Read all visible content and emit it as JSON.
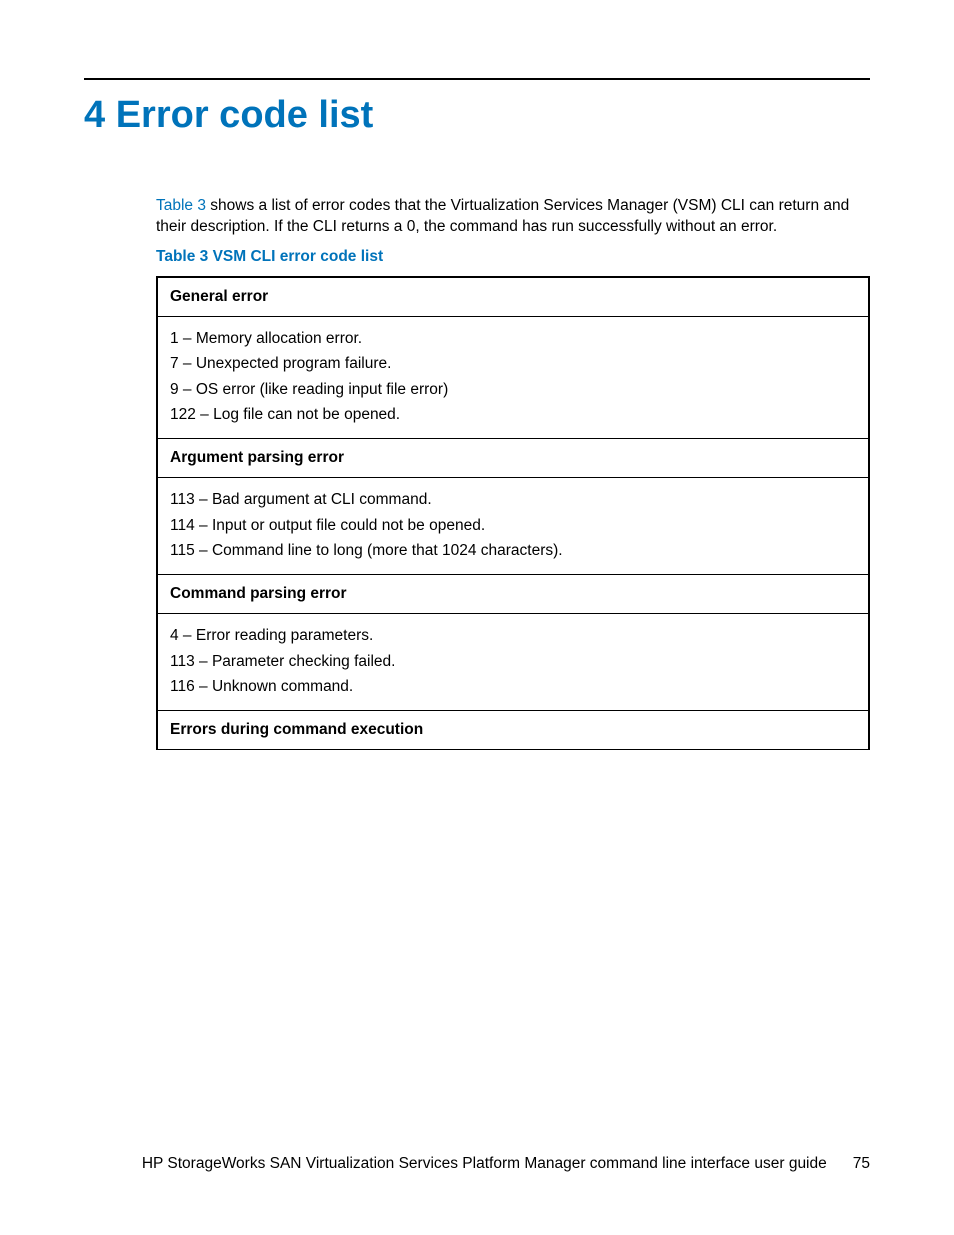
{
  "chapter": {
    "number": "4",
    "title": "Error code list"
  },
  "intro": {
    "link_text": "Table 3",
    "text_after": " shows a list of error codes that the Virtualization Services Manager (VSM) CLI can return and their description. If the CLI returns a 0, the command has run successfully without an error."
  },
  "table_caption": "Table 3 VSM CLI error code list",
  "sections": [
    {
      "header": "General error",
      "items": [
        "1 – Memory allocation error.",
        "7 – Unexpected program failure.",
        "9 – OS error (like reading input file error)",
        "122 – Log file can not be opened."
      ]
    },
    {
      "header": "Argument parsing error",
      "items": [
        "113 – Bad argument at CLI command.",
        "114 – Input or output file could not be opened.",
        "115 – Command line to long (more that 1024 characters)."
      ]
    },
    {
      "header": "Command parsing error",
      "items": [
        "4 – Error reading parameters.",
        "113 – Parameter checking failed.",
        "116 – Unknown command."
      ]
    },
    {
      "header": "Errors during command execution",
      "items": []
    }
  ],
  "footer": {
    "doc_title": "HP StorageWorks SAN Virtualization Services Platform Manager command line interface user guide",
    "page_number": "75"
  }
}
